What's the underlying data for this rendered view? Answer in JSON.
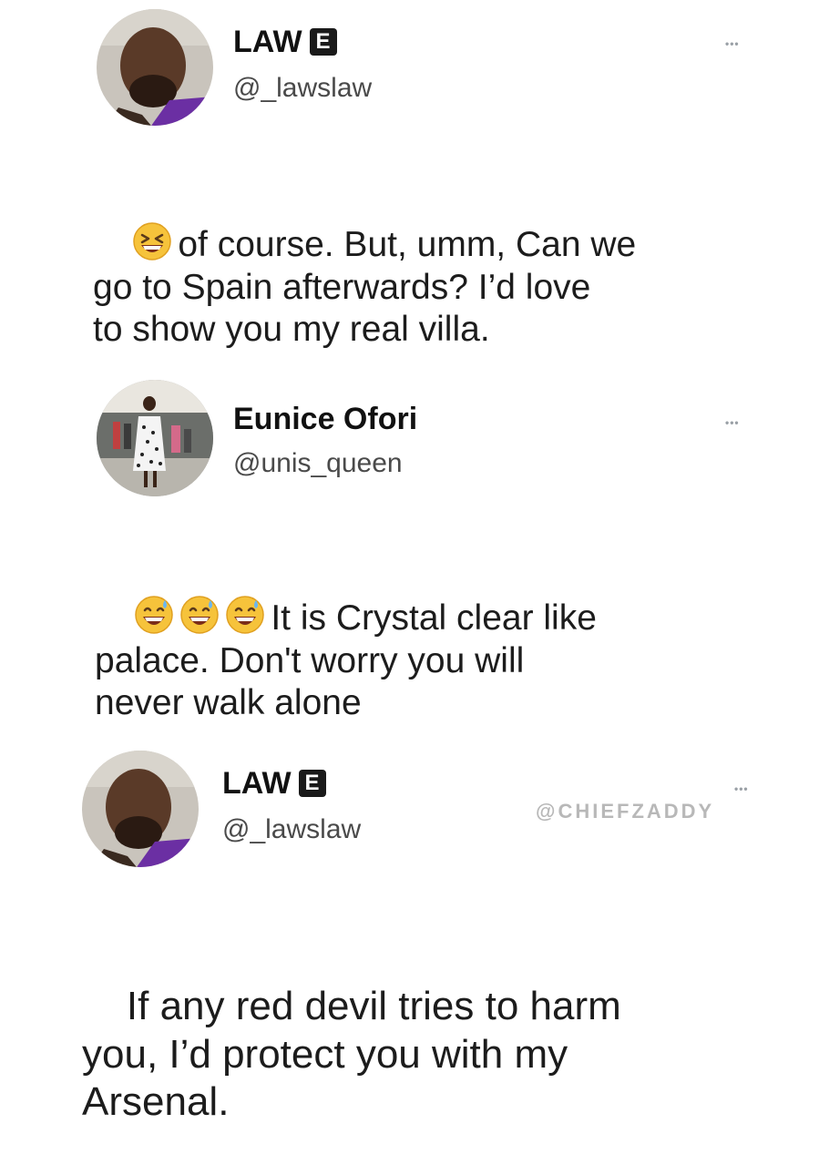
{
  "tweets": [
    {
      "name": "LAW",
      "badge": "E",
      "handle": "@_lawslaw",
      "more": "•••",
      "text": "of course. But, umm, Can we\ngo to Spain afterwards? I’d love\nto show you my real villa.",
      "emojis": [
        "grinning-squinting-face"
      ]
    },
    {
      "name": "Eunice Ofori",
      "handle": "@unis_queen",
      "more": "•••",
      "text": "It is Crystal clear like\npalace. Don't worry you will\nnever walk alone",
      "emojis": [
        "grinning-face-with-sweat",
        "grinning-face-with-sweat",
        "grinning-face-with-sweat"
      ]
    },
    {
      "name": "LAW",
      "badge": "E",
      "handle": "@_lawslaw",
      "more": "•••",
      "text": "If any red devil tries to harm\nyou, I’d protect you with my\nArsenal."
    }
  ],
  "watermark": "@CHIEFZADDY"
}
